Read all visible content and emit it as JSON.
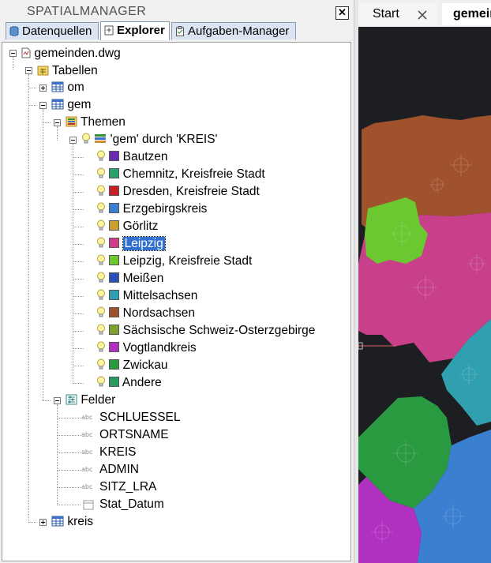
{
  "panel": {
    "title": "SPATIALMANAGER",
    "close_glyph": "✕",
    "tabs": [
      {
        "label": "Datenquellen",
        "icon": "database-icon"
      },
      {
        "label": "Explorer",
        "icon": "explorer-icon"
      },
      {
        "label": "Aufgaben-Manager",
        "icon": "clipboard-icon"
      }
    ],
    "active_tab": "Explorer"
  },
  "tree": {
    "root": "gemeinden.dwg",
    "tables_label": "Tabellen",
    "table_om": "om",
    "table_gem": "gem",
    "themes_label": "Themen",
    "theme_name": "'gem' durch 'KREIS'",
    "theme_items": [
      {
        "label": "Bautzen",
        "color": "#6a2bb0"
      },
      {
        "label": "Chemnitz, Kreisfreie Stadt",
        "color": "#2aa06a"
      },
      {
        "label": "Dresden, Kreisfreie Stadt",
        "color": "#c81e28"
      },
      {
        "label": "Erzgebirgskreis",
        "color": "#3a7fd0"
      },
      {
        "label": "Görlitz",
        "color": "#c8a030"
      },
      {
        "label": "Leipzig",
        "color": "#d03c8c",
        "selected": true
      },
      {
        "label": "Leipzig, Kreisfreie Stadt",
        "color": "#6cc830"
      },
      {
        "label": "Meißen",
        "color": "#2a50b8"
      },
      {
        "label": "Mittelsachsen",
        "color": "#30a0b0"
      },
      {
        "label": "Nordsachsen",
        "color": "#a0522d"
      },
      {
        "label": "Sächsische Schweiz-Osterzgebirge",
        "color": "#80a030"
      },
      {
        "label": "Vogtlandkreis",
        "color": "#b030c0"
      },
      {
        "label": "Zwickau",
        "color": "#2a9a40"
      },
      {
        "label": "Andere",
        "color": "#2a9a60"
      }
    ],
    "fields_label": "Felder",
    "field_type": "abc",
    "fields": [
      "SCHLUESSEL",
      "ORTSNAME",
      "KREIS",
      "ADMIN",
      "SITZ_LRA",
      "Stat_Datum"
    ],
    "table_kreis": "kreis"
  },
  "document": {
    "tabs": [
      {
        "label": "Start"
      },
      {
        "label": "gemein"
      }
    ]
  },
  "map_colors": {
    "background": "#1d1e22",
    "nordsachsen": "#a0522d",
    "leipzig": "#c8408a",
    "leipzig_stadt": "#6cc830",
    "mittelsachsen": "#30a0b0",
    "zwickau": "#2a9a40",
    "vogtland": "#b030c0",
    "erzgebirge": "#3a7fd0"
  }
}
